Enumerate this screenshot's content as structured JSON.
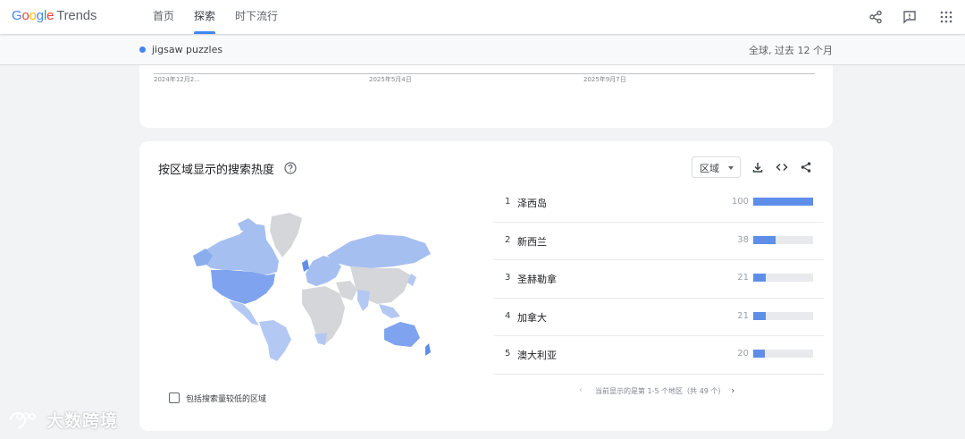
{
  "header": {
    "logo_google": "Google",
    "logo_trends": "Trends",
    "nav": [
      {
        "label": "首页"
      },
      {
        "label": "探索"
      },
      {
        "label": "时下流行"
      }
    ],
    "icons": [
      "share-icon",
      "feedback-icon",
      "apps-icon"
    ]
  },
  "subbar": {
    "term": "jigsaw puzzles",
    "term_color": "#4285f4",
    "scope": "全球, 过去 12 个月"
  },
  "timeline": {
    "labels": [
      "2024年12月2...",
      "2025年5月4日",
      "2025年9月7日"
    ]
  },
  "region_section": {
    "title": "按区域显示的搜索热度",
    "dropdown_value": "区域",
    "include_low_volume_label": "包括搜索量较低的区域",
    "include_low_volume_checked": false,
    "regions": [
      {
        "rank": "1",
        "name": "泽西岛",
        "value": "100",
        "score": 100
      },
      {
        "rank": "2",
        "name": "新西兰",
        "value": "38",
        "score": 38
      },
      {
        "rank": "3",
        "name": "圣赫勒拿",
        "value": "21",
        "score": 21
      },
      {
        "rank": "4",
        "name": "加拿大",
        "value": "21",
        "score": 21
      },
      {
        "rank": "5",
        "name": "澳大利亚",
        "value": "20",
        "score": 20
      }
    ],
    "pager_text": "当前显示的是第 1-5 个地区（共 49 个）",
    "accent": "#5e8ee8"
  },
  "watermark": {
    "text": "大数跨境"
  }
}
